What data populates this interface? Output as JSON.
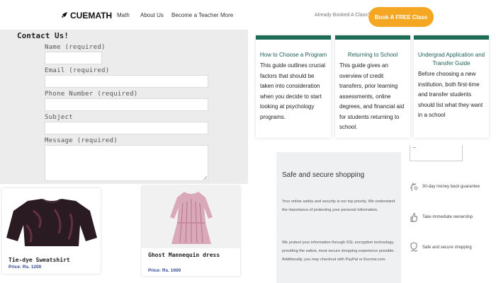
{
  "header": {
    "logo_text": "CUEMATH",
    "nav": [
      "Math",
      "About Us",
      "Become a Teacher",
      "More"
    ],
    "already_booked": "Already Booked A Class?",
    "cta": "Book A FREE Class",
    "colors": {
      "cta": "#f5a623"
    }
  },
  "contact": {
    "title": "Contact Us!",
    "fields": {
      "name": "Name (required)",
      "email": "Email (required)",
      "phone": "Phone Number (required)",
      "subject": "Subject",
      "message": "Message (required)"
    }
  },
  "guides": [
    {
      "title": "How to Choose a Program",
      "body": "This guide outlines crucial factors that should be taken into consideration when you decide to start looking at psychology programs."
    },
    {
      "title": "Returning to School",
      "body": "This guide gives an overview of credit transfers, prior learning assessments, online degrees, and financial aid for students returning to school."
    },
    {
      "title": "Undergrad Application and Transfer Guide",
      "body": "Before choosing a new institution, both first-time and transfer students should list what they want in a school"
    }
  ],
  "shopping": {
    "title": "Safe and secure shopping",
    "p1": "Your online safety and security is our top priority. We understand the importance of protecting your personal information.",
    "p2": "We protect your information through SSL encryption technology, providing the safest, most secure shopping experience possible. Additionally, you may checkout with PayPal or Escrow.com."
  },
  "widget_text": "...",
  "features": [
    "30-day money back guarantee",
    "Take immediate ownership",
    "Safe and secure shopping"
  ],
  "products": [
    {
      "name": "Tie-dye Sweatshirt",
      "price": "Price: Rs. 1200"
    },
    {
      "name": "Ghost Mannequin dress",
      "price": "Price: Rs. 1000"
    }
  ]
}
